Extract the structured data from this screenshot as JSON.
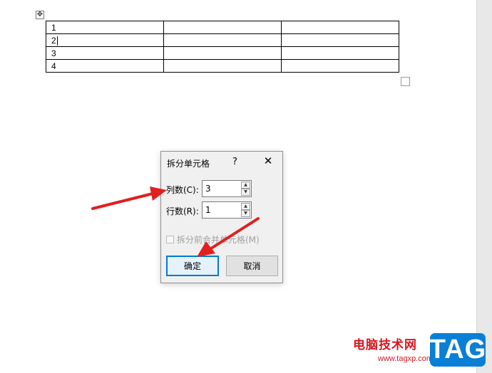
{
  "table": {
    "rows": [
      [
        "1",
        "",
        ""
      ],
      [
        "2",
        "",
        ""
      ],
      [
        "3",
        "",
        ""
      ],
      [
        "4",
        "",
        ""
      ]
    ]
  },
  "dialog": {
    "title": "拆分单元格",
    "help": "?",
    "close": "✕",
    "columns_label": "列数(C):",
    "columns_value": "3",
    "rows_label": "行数(R):",
    "rows_value": "1",
    "merge_checkbox_label": "拆分前合并单元格(M)",
    "merge_checked": false,
    "ok_label": "确定",
    "cancel_label": "取消"
  },
  "watermark": {
    "site_name": "电脑技术网",
    "url": "www.tagxp.com",
    "badge": "TAG"
  },
  "colors": {
    "arrow": "#e02020",
    "dialog_bg": "#f0f0f0",
    "primary_border": "#0078d7",
    "watermark_red": "#d9161f",
    "badge_blue": "#0a7fd6"
  },
  "icons": {
    "move_handle": "move-cross-icon",
    "spin_up": "caret-up-icon",
    "spin_down": "caret-down-icon",
    "arrows": "red-pointer-arrow"
  }
}
